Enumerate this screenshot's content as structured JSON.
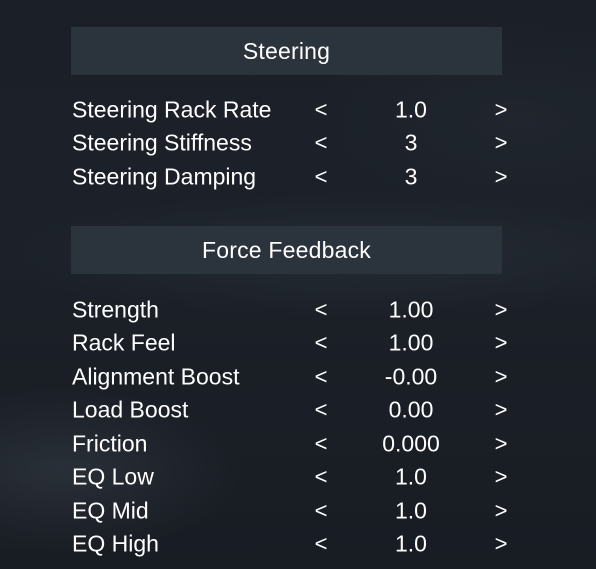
{
  "steering": {
    "title": "Steering",
    "rows": [
      {
        "label": "Steering Rack Rate",
        "value": "1.0"
      },
      {
        "label": "Steering Stiffness",
        "value": "3"
      },
      {
        "label": "Steering Damping",
        "value": "3"
      }
    ]
  },
  "force_feedback": {
    "title": "Force Feedback",
    "rows": [
      {
        "label": "Strength",
        "value": "1.00"
      },
      {
        "label": "Rack Feel",
        "value": "1.00"
      },
      {
        "label": "Alignment Boost",
        "value": "-0.00"
      },
      {
        "label": "Load Boost",
        "value": "0.00"
      },
      {
        "label": "Friction",
        "value": "0.000"
      },
      {
        "label": "EQ Low",
        "value": "1.0"
      },
      {
        "label": "EQ Mid",
        "value": "1.0"
      },
      {
        "label": "EQ High",
        "value": "1.0"
      }
    ]
  },
  "controls": {
    "decrease_glyph": "<",
    "increase_glyph": ">"
  },
  "icons": {
    "decrease": "chevron-left-icon",
    "increase": "chevron-right-icon"
  }
}
